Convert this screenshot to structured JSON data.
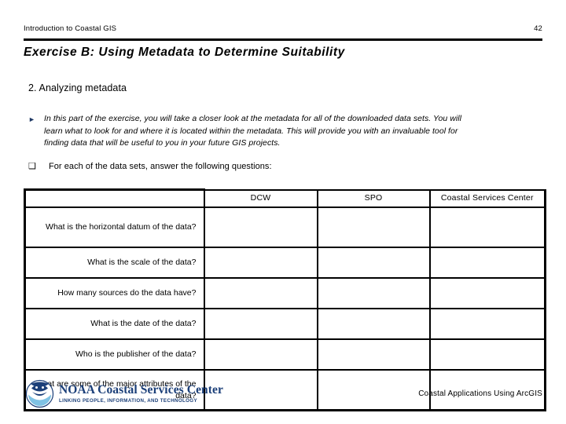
{
  "header": {
    "course_title": "Introduction to Coastal GIS",
    "page_number": "42"
  },
  "exercise": {
    "title": "Exercise B: Using Metadata to Determine Suitability"
  },
  "section": {
    "heading": "2. Analyzing metadata"
  },
  "bullets": [
    {
      "marker": "►",
      "marker_name": "triangle-bullet-icon",
      "text": "In this part of the exercise, you will take a closer look at the metadata for all of the downloaded data sets. You will learn what to look for and where it is located within the metadata. This will provide you with an invaluable tool for finding data that will be useful to you in your future GIS projects."
    },
    {
      "marker": "❑",
      "marker_name": "square-bullet-icon",
      "text": "For each of the data sets, answer the following questions:"
    }
  ],
  "table": {
    "columns": [
      "",
      "DCW",
      "SPO",
      "Coastal Services Center"
    ],
    "rows": [
      {
        "label": "What is the horizontal datum of the data?",
        "answers": [
          "",
          "",
          ""
        ]
      },
      {
        "label": "What is the scale of the data?",
        "answers": [
          "",
          "",
          ""
        ]
      },
      {
        "label": "How many sources do the data have?",
        "answers": [
          "",
          "",
          ""
        ]
      },
      {
        "label": "What is the date of the data?",
        "answers": [
          "",
          "",
          ""
        ]
      },
      {
        "label": "Who is the publisher of the data?",
        "answers": [
          "",
          "",
          ""
        ]
      },
      {
        "label": "What are some of the major attributes of the data?",
        "answers": [
          "",
          "",
          ""
        ]
      }
    ]
  },
  "footer": {
    "logo_title": "NOAA Coastal Services Center",
    "logo_tagline": "LINKING PEOPLE, INFORMATION, AND TECHNOLOGY",
    "logo_color": "#1b3f79",
    "right_text": "Coastal Applications Using ArcGIS"
  }
}
